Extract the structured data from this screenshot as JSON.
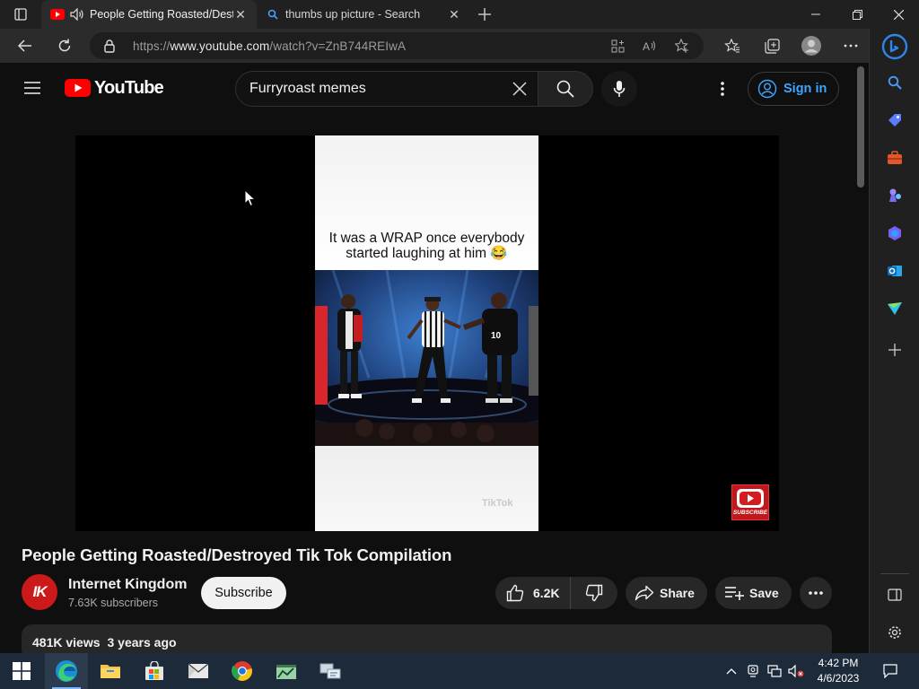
{
  "browser": {
    "tabs": [
      {
        "title": "People Getting Roasted/Destroyed Tik Tok Compilation",
        "active": true,
        "favicon": "youtube-icon",
        "audio": true
      },
      {
        "title": "thumbs up picture - Search",
        "active": false,
        "favicon": "bing-search-icon"
      }
    ],
    "url_scheme": "https://",
    "url_host": "www.youtube.com",
    "url_path": "/watch?v=ZnB744REIwA"
  },
  "youtube": {
    "logo_text": "YouTube",
    "search_value": "Furryroast memes",
    "sign_in_label": "Sign in",
    "video": {
      "caption_line1": "It was a WRAP once everybody",
      "caption_line2": "started laughing at him 😂",
      "watermark": "TikTok",
      "subscribe_badge": "SUBSCRIBE"
    },
    "title": "People Getting Roasted/Destroyed Tik Tok Compilation",
    "channel": {
      "name": "Internet Kingdom",
      "subscribers": "7.63K subscribers",
      "avatar_text": "IK"
    },
    "subscribe_label": "Subscribe",
    "likes": "6.2K",
    "share_label": "Share",
    "save_label": "Save",
    "views": "481K views",
    "age": "3 years ago"
  },
  "taskbar": {
    "time": "4:42 PM",
    "date": "4/6/2023"
  },
  "colors": {
    "youtube_red": "#ff0000",
    "link_blue": "#3ea6ff",
    "page_bg": "#0f0f0f",
    "pill_bg": "#272727"
  }
}
